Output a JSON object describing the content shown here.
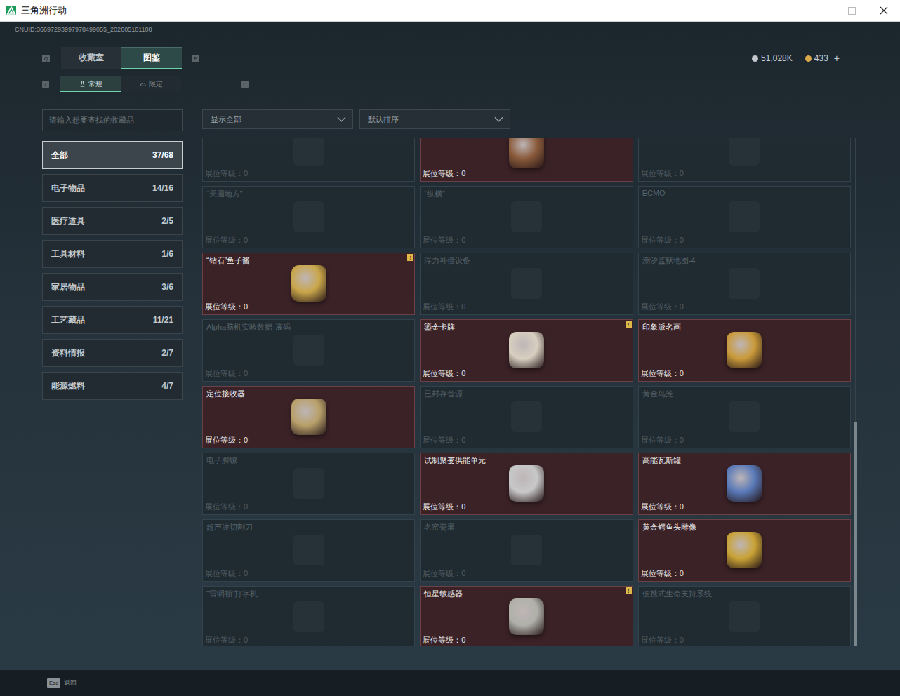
{
  "window": {
    "title": "三角洲行动"
  },
  "header": {
    "uid": "CNUID:36697293997978499055_202605101108",
    "currencies": [
      {
        "amount": "51,028K",
        "color": "#c4c8cc"
      },
      {
        "amount": "433",
        "color": "#d9a84a"
      }
    ],
    "add": "+"
  },
  "tab_keys": [
    "Q",
    "E"
  ],
  "tabs": [
    {
      "label": "收藏室",
      "selected": false
    },
    {
      "label": "图鉴",
      "selected": true
    }
  ],
  "subtab_keys": [
    "Z",
    "C"
  ],
  "subtabs": [
    {
      "label": "常规",
      "selected": true
    },
    {
      "label": "限定",
      "selected": false
    }
  ],
  "search": {
    "placeholder": "请输入想要查找的收藏品"
  },
  "filters": [
    "显示全部",
    "默认排序"
  ],
  "sidebar": {
    "items": [
      {
        "label": "全部",
        "count": "37/68",
        "selected": true
      },
      {
        "label": "电子物品",
        "count": "14/16",
        "selected": false
      },
      {
        "label": "医疗道具",
        "count": "2/5",
        "selected": false
      },
      {
        "label": "工具材料",
        "count": "1/6",
        "selected": false
      },
      {
        "label": "家居物品",
        "count": "3/6",
        "selected": false
      },
      {
        "label": "工艺藏品",
        "count": "11/21",
        "selected": false
      },
      {
        "label": "资料情报",
        "count": "2/7",
        "selected": false
      },
      {
        "label": "能源燃料",
        "count": "4/7",
        "selected": false
      }
    ]
  },
  "grid": {
    "level_label": "展位等级：",
    "items": [
      {
        "owned": false,
        "display_level": "0"
      },
      {
        "owned": true,
        "display_level": "0",
        "color": "#8a5a3a"
      },
      {
        "owned": false,
        "display_level": "0"
      },
      {
        "name": "“天圆地方”",
        "owned": false,
        "display_level": "0"
      },
      {
        "name": "“纵横”",
        "owned": false,
        "display_level": "0"
      },
      {
        "name": "ECMO",
        "owned": false,
        "display_level": "0"
      },
      {
        "name": "“钻石”鱼子酱",
        "owned": true,
        "display_level": "0",
        "badge": "!",
        "color": "#c9a64a"
      },
      {
        "name": "浮力补偿设备",
        "owned": false,
        "display_level": "0"
      },
      {
        "name": "潮汐监狱地图-4",
        "owned": false,
        "display_level": "0"
      },
      {
        "name": "Alpha脑机实验数据-液码",
        "owned": false,
        "display_level": "0"
      },
      {
        "name": "鎏金卡牌",
        "owned": true,
        "display_level": "0",
        "badge": "!",
        "color": "#d8cfc0"
      },
      {
        "name": "印象派名画",
        "owned": true,
        "display_level": "0",
        "color": "#c99a3a"
      },
      {
        "name": "定位接收器",
        "owned": true,
        "display_level": "0",
        "color": "#b8a06a"
      },
      {
        "name": "已封存音源",
        "owned": false,
        "display_level": "0"
      },
      {
        "name": "黄金鸟笼",
        "owned": false,
        "display_level": "0"
      },
      {
        "name": "电子脚镣",
        "owned": false,
        "display_level": "0"
      },
      {
        "name": "试制聚变供能单元",
        "owned": true,
        "display_level": "0",
        "color": "#c8c8c8"
      },
      {
        "name": "高能瓦斯罐",
        "owned": true,
        "display_level": "0",
        "color": "#5a7ab8"
      },
      {
        "name": "超声波切割刀",
        "owned": false,
        "display_level": "0"
      },
      {
        "name": "名窑瓷器",
        "owned": false,
        "display_level": "0"
      },
      {
        "name": "黄金鳄鱼头雕像",
        "owned": true,
        "display_level": "0",
        "color": "#c9a235"
      },
      {
        "name": "“雷明顿”打字机",
        "owned": false,
        "display_level": "0"
      },
      {
        "name": "恒星敏感器",
        "owned": true,
        "display_level": "0",
        "badge": "!",
        "color": "#b0b0a8"
      },
      {
        "name": "便携式生命支持系统",
        "owned": false,
        "display_level": "0"
      }
    ]
  },
  "scrollbar": {
    "level": 1,
    "thumb": 0.44
  },
  "footer": {
    "key": "Esc",
    "label": "返回"
  }
}
